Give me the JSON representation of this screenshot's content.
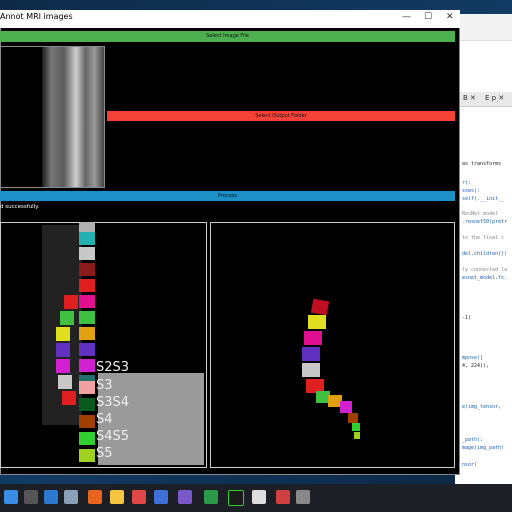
{
  "window": {
    "title": "Annot MRI images",
    "minimize": "—",
    "maximize": "☐",
    "close": "✕"
  },
  "buttons": {
    "select_image": "Select Image File",
    "select_output": "Select Output Folder",
    "process": "Process"
  },
  "status_text": "d successfully.",
  "legend": [
    {
      "label": "",
      "color": "#b0b0b0"
    },
    {
      "label": "",
      "color": "#22b0b0"
    },
    {
      "label": "",
      "color": "#c8c8c8"
    },
    {
      "label": "",
      "color": "#8b1a1a"
    },
    {
      "label": "",
      "color": "#e02020"
    },
    {
      "label": "",
      "color": "#e01090"
    },
    {
      "label": "",
      "color": "#40c040"
    },
    {
      "label": "",
      "color": "#e0a010"
    },
    {
      "label": "",
      "color": "#6030c0"
    },
    {
      "label": "",
      "color": "#d020d0"
    },
    {
      "label": "S2S3",
      "color": "#207070"
    },
    {
      "label": "S3",
      "color": "#f0a0a0"
    },
    {
      "label": "S3S4",
      "color": "#0a5a20"
    },
    {
      "label": "S4",
      "color": "#a04000"
    },
    {
      "label": "S4S5",
      "color": "#30d030"
    },
    {
      "label": "S5",
      "color": "#a0d020"
    }
  ],
  "ide": {
    "tab1": "B ✕",
    "tab2": "E p ✕",
    "code_lines": [
      "as transforms",
      "r):",
      "sses):",
      "self).__init__",
      "ResNet model",
      ".resnet50(pretr",
      "to the final c",
      "del.children())",
      "ly connected la",
      "esnet_model.fc.",
      "-1)",
      "mpose([",
      "4, 224)),",
      "e(img_tensor,",
      "_path):",
      "mage(img_path)",
      "nsor)"
    ]
  },
  "colors": {
    "accent_green": "#4caf50",
    "accent_red": "#f44336",
    "accent_blue": "#1e90c8"
  }
}
